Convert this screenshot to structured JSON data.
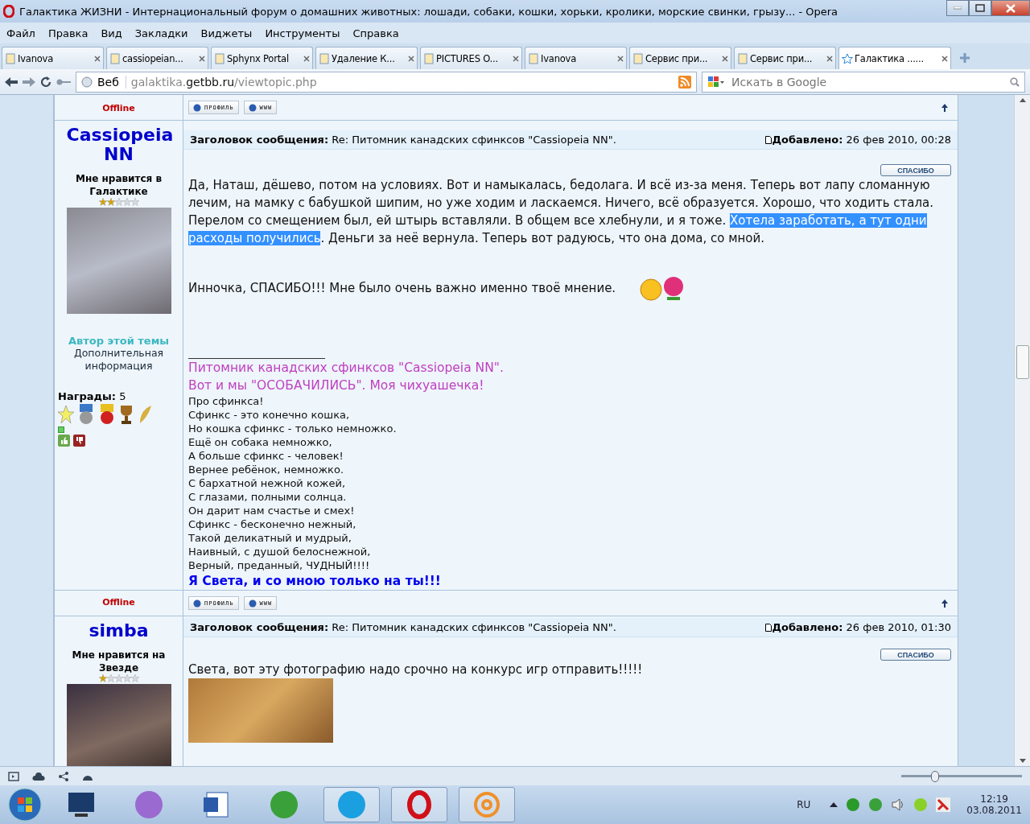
{
  "window": {
    "title": "Галактика ЖИЗНИ - Интернациональный форум о домашних животных: лошади, собаки, кошки, хорьки, кролики, морские свинки, грызу... - Opera"
  },
  "menu": [
    "Файл",
    "Правка",
    "Вид",
    "Закладки",
    "Виджеты",
    "Инструменты",
    "Справка"
  ],
  "tabs": [
    {
      "label": "Ivanova",
      "selected": false
    },
    {
      "label": "cassiopeian...",
      "selected": false
    },
    {
      "label": "Sphynx Portal",
      "selected": false
    },
    {
      "label": "Удаление К...",
      "selected": false
    },
    {
      "label": "PICTURES O...",
      "selected": false
    },
    {
      "label": "Ivanova",
      "selected": false
    },
    {
      "label": "Сервис при...",
      "selected": false
    },
    {
      "label": "Сервис при...",
      "selected": false
    },
    {
      "label": "Галактика ......",
      "selected": true
    }
  ],
  "address": {
    "scope": "Веб",
    "url_host_start": "galaktika.",
    "url_domain": "getbb.ru",
    "url_path": "/viewtopic.php",
    "search_placeholder": "Искать в Google"
  },
  "previous_post_footer": {
    "status": "Offline",
    "buttons": [
      "ПРОФИЛЬ",
      "WWW"
    ]
  },
  "posts": [
    {
      "author": "Cassiopeia NN",
      "rank": "Мне нравится в Галактике",
      "stars": 2,
      "topic_author": "Автор этой темы",
      "extra_info": "Дополнительная информация",
      "awards_label": "Награды:",
      "awards_count": "5",
      "subject_label": "Заголовок сообщения:",
      "subject": "Re: Питомник канадских сфинксов \"Cassiopeia NN\".",
      "added_label": "Добавлено:",
      "added": "26 фев 2010, 00:28",
      "thanks": "СПАСИБО",
      "text_before": "Да, Наташ, дёшево, потом на условиях. Вот и намыкалась, бедолага. И всё из-за меня. Теперь вот лапу сломанную лечим, на мамку с бабушкой шипим, но уже ходим и ласкаемся. Ничего, всё образуется. Хорошо, что ходить стала. Перелом со смещением был, ей штырь вставляли. В общем все хлебнули, и я тоже. ",
      "text_selected": "Хотела заработать, а тут одни расходы получились",
      "text_after": ". Деньги за неё вернула. Теперь вот радуюсь, что она дома, со мной.",
      "text_thanks": "Инночка, СПАСИБО!!! Мне было очень важно именно твоё мнение.",
      "signature_links": [
        "Питомник канадских сфинксов \"Cassiopeia NN\".",
        "Вот и мы \"ОСОБАЧИЛИСЬ\". Моя чихуашечка!"
      ],
      "poem": [
        "Про сфинкса!",
        "Сфинкс - это конечно кошка,",
        "Но кошка сфинкс - только немножко.",
        "Ещё он собака немножко,",
        "А больше сфинкс - человек!",
        "Вернее ребёнок, немножко.",
        "С бархатной нежной кожей,",
        "С глазами, полными солнца.",
        "Он дарит нам счастье и смех!",
        "Сфинкс - бесконечно нежный,",
        "Такой деликатный и мудрый,",
        "Наивный, с душой белоснежной,",
        "Верный, преданный, ЧУДНЫЙ!!!!"
      ],
      "signature_motto": "Я Света, и со мною только на ты!!!",
      "status": "Offline",
      "buttons": [
        "ПРОФИЛЬ",
        "WWW"
      ]
    },
    {
      "author": "simba",
      "rank": "Мне нравится на Звезде",
      "stars": 1,
      "subject_label": "Заголовок сообщения:",
      "subject": "Re: Питомник канадских сфинксов \"Cassiopeia NN\".",
      "added_label": "Добавлено:",
      "added": "26 фев 2010, 01:30",
      "thanks": "СПАСИБО",
      "text_before": "Света, вот эту фотографию надо срочно на конкурс игр отправить!!!!!"
    }
  ],
  "zoom": {
    "level": 0.28
  },
  "tray": {
    "language": "RU",
    "time": "12:19",
    "date": "03.08.2011"
  }
}
